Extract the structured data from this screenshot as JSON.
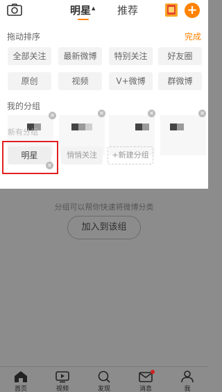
{
  "header": {
    "active_tab": "明星",
    "recommend_tab": "推荐",
    "accent_color": "#ff8200"
  },
  "panel": {
    "sort_label": "拖动排序",
    "done_label": "完成",
    "chips": [
      "全部关注",
      "最新微博",
      "特别关注",
      "好友圈",
      "原创",
      "视频",
      "V+微博",
      "群微博"
    ],
    "my_groups_label": "我的分组",
    "new_group_placeholder": "新有分组",
    "mingxing_group": "明星",
    "quiet_follow": "悄悄关注",
    "new_group_button": "+新建分组"
  },
  "overlay": {
    "hint": "分组可以帮你快速将微博分类",
    "join_button": "加入到该组"
  },
  "nav": {
    "items": [
      "首页",
      "视频",
      "发现",
      "消息",
      "我"
    ]
  },
  "icons": [
    "camera-icon",
    "promo-card-icon",
    "plus-icon",
    "close-icon",
    "home-icon",
    "video-icon",
    "discover-icon",
    "message-icon",
    "profile-icon"
  ],
  "highlight_color": "#e02020"
}
